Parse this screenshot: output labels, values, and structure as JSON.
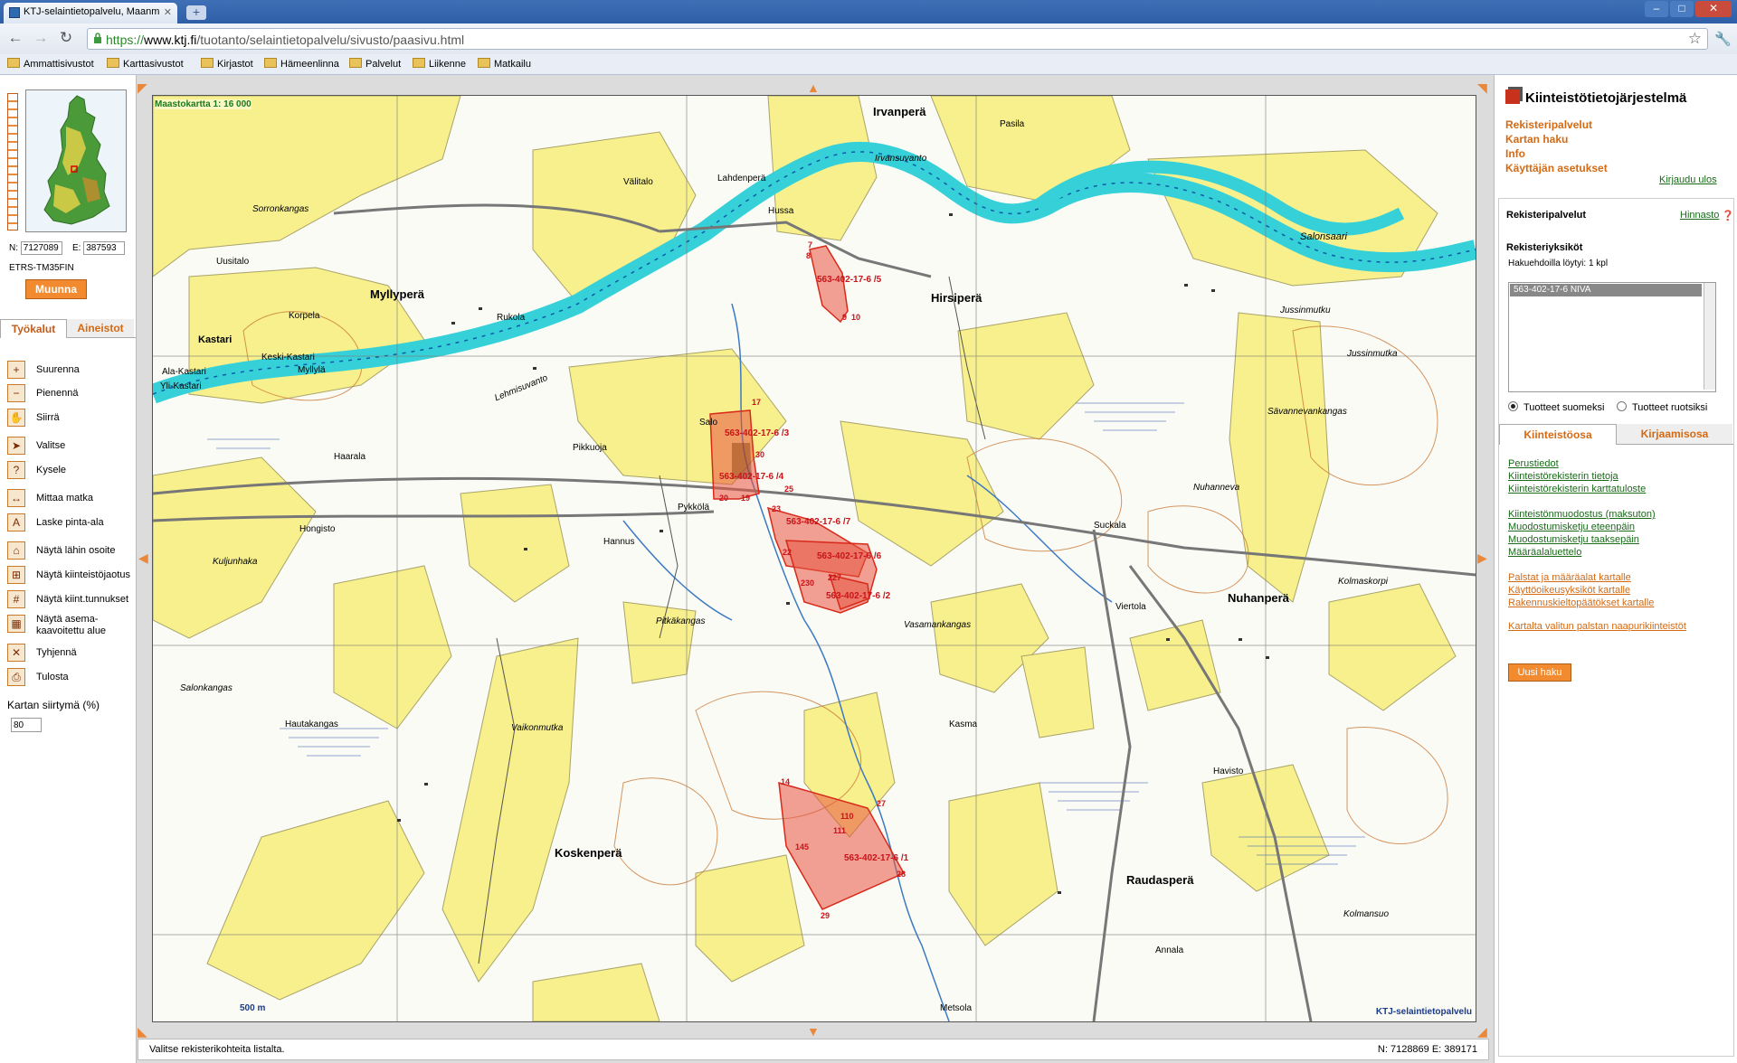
{
  "browser": {
    "tab_title": "KTJ-selaintietopalvelu, Maanm",
    "url_proto": "https://",
    "url_host": "www.ktj.fi",
    "url_path": "/tuotanto/selaintietopalvelu/sivusto/paasivu.html",
    "bookmarks": [
      "Ammattisivustot",
      "Karttasivustot",
      "Kirjastot",
      "Hämeenlinna",
      "Palvelut",
      "Liikenne",
      "Matkailu"
    ]
  },
  "left": {
    "coord_n_label": "N:",
    "coord_n": "7127089",
    "coord_e_label": "E:",
    "coord_e": "387593",
    "crs": "ETRS-TM35FIN",
    "convert_label": "Muunna",
    "tabs": [
      "Työkalut",
      "Aineistot"
    ],
    "tools": [
      {
        "label": "Suurenna",
        "icon": "zoom-in-icon",
        "glyph": "+"
      },
      {
        "label": "Pienennä",
        "icon": "zoom-out-icon",
        "glyph": "−"
      },
      {
        "label": "Siirrä",
        "icon": "hand-pan-icon",
        "glyph": "✋"
      },
      {
        "label": "Valitse",
        "icon": "pointer-icon",
        "glyph": "➤"
      },
      {
        "label": "Kysele",
        "icon": "query-icon",
        "glyph": "?"
      },
      {
        "label": "Mittaa matka",
        "icon": "ruler-icon",
        "glyph": "↔"
      },
      {
        "label": "Laske pinta-ala",
        "icon": "area-icon",
        "glyph": "A"
      },
      {
        "label": "Näytä lähin osoite",
        "icon": "address-icon",
        "glyph": "⌂"
      },
      {
        "label": "Näytä kiinteistöjaotus",
        "icon": "parcel-division-icon",
        "glyph": "⊞"
      },
      {
        "label": "Näytä kiint.tunnukset",
        "icon": "property-id-icon",
        "glyph": "#"
      },
      {
        "label": "Näytä asema-kaavoitettu alue",
        "icon": "zoning-icon",
        "glyph": "▦"
      },
      {
        "label": "Tyhjennä",
        "icon": "eraser-icon",
        "glyph": "✕"
      },
      {
        "label": "Tulosta",
        "icon": "printer-icon",
        "glyph": "⎙"
      }
    ],
    "shift_label": "Kartan siirtymä (%)",
    "shift_value": "80"
  },
  "map": {
    "scale_label": "Maastokartta 1: 16 000",
    "scalebar_label": "500 m",
    "copyright": "KTJ-selaintietopalvelu",
    "colors": {
      "field": "#f7f08c",
      "water": "#36d1d8",
      "parcel": "#e8533f",
      "road": "#8a8a8a"
    },
    "places": [
      "Irvanperä",
      "Myllyperä",
      "Hirsiperä",
      "Nuhanperä",
      "Koskenperä",
      "Raudasperä",
      "Kastari",
      "Salonsaari",
      "Hussa",
      "Lahdenperä",
      "Hongisto",
      "Pykkölä",
      "Hannus",
      "Suckala",
      "Salo",
      "Kuljunhaka",
      "Pitkäkangas",
      "Vaikonmutka",
      "Hautakangas",
      "Salonkangas",
      "Metsola",
      "Annala",
      "Välitalo",
      "Uusitalo",
      "Sorronkangas",
      "Rukola",
      "Korpela",
      "Keski-Kastari",
      "Ala-Kastari",
      "Yli-Kastari",
      "Myllylä",
      "Haarala",
      "Pikkuoja",
      "Lehmisuvanto",
      "Irvansuvanto",
      "Pasila",
      "Jussinmutku",
      "Sävannevankangas",
      "Nuhanneva",
      "Vasamankangas",
      "Kasma",
      "Kolmaskorpi",
      "Havisto",
      "Kolmansuo",
      "Viertola",
      "Jussinmutka"
    ],
    "parcels": [
      "563-402-17-6 /5",
      "563-402-17-6 /3",
      "563-402-17-6 /4",
      "563-402-17-6 /7",
      "563-402-17-6 /6",
      "563-402-17-6 /2",
      "563-402-17-6 /1"
    ],
    "points": [
      "7",
      "8",
      "9",
      "10",
      "17",
      "30",
      "25",
      "23",
      "22",
      "20",
      "19",
      "230",
      "227",
      "14",
      "110",
      "111",
      "27",
      "28",
      "29",
      "145"
    ]
  },
  "status": {
    "message": "Valitse rekisterikohteita listalta.",
    "coords": "N: 7128869  E: 389171"
  },
  "right": {
    "title": "Kiinteistötietojärjestelmä",
    "menu": [
      "Rekisteripalvelut",
      "Kartan haku",
      "Info",
      "Käyttäjän asetukset"
    ],
    "logout": "Kirjaudu ulos",
    "section_title": "Rekisteripalvelut",
    "price_link": "Hinnasto",
    "units_title": "Rekisteriyksiköt",
    "found_label": "Hakuehdoilla löytyi:",
    "found_count": "1 kpl",
    "list_items": [
      "563-402-17-6   NIVA"
    ],
    "radio_fi": "Tuotteet suomeksi",
    "radio_sv": "Tuotteet ruotsiksi",
    "tabs": [
      "Kiinteistöosa",
      "Kirjaamisosa"
    ],
    "links_group1": [
      "Perustiedot",
      "Kiinteistörekisterin tietoja",
      "Kiinteistörekisterin karttatuloste"
    ],
    "links_group2": [
      "Kiinteistönmuodostus (maksuton)",
      "Muodostumisketju eteenpäin",
      "Muodostumisketju taaksepäin",
      "Määräalaluettelo"
    ],
    "links_group3": [
      "Palstat ja määräalat kartalle",
      "Käyttöoikeusyksiköt kartalle",
      "Rakennuskieltopäätökset kartalle"
    ],
    "links_group4": [
      "Kartalta valitun palstan naapurikiinteistöt"
    ],
    "new_search": "Uusi haku"
  }
}
